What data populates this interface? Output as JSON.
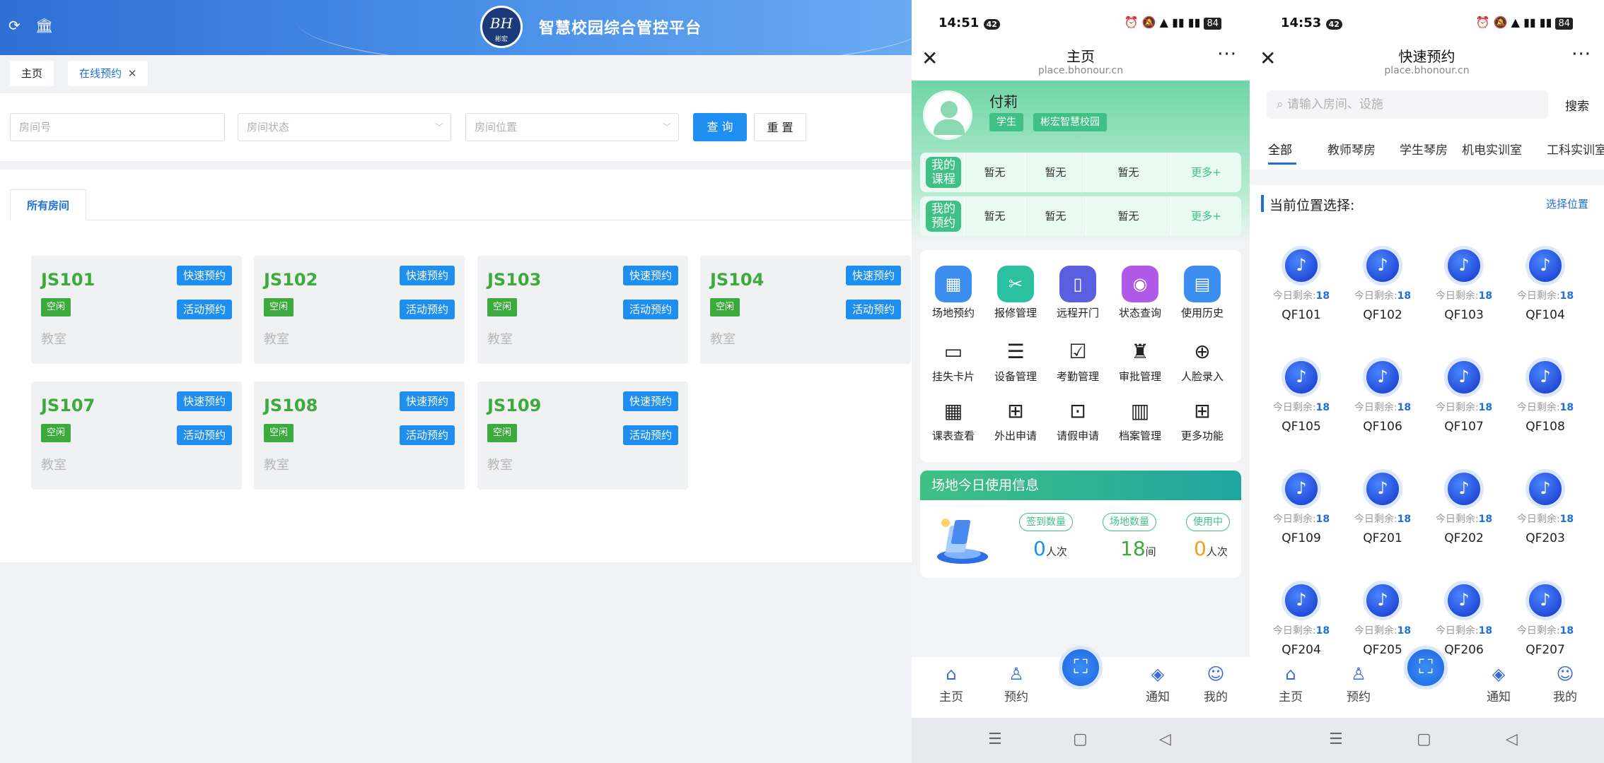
{
  "desktop": {
    "platform_title": "智慧校园综合管控平台",
    "logo_text": "BH",
    "logo_sub": "彬宏",
    "tabs": {
      "home": "主页",
      "booking": "在线预约",
      "close": "✕"
    },
    "filters": {
      "room_no": "房间号",
      "room_status": "房间状态",
      "room_location": "房间位置",
      "query": "查 询",
      "reset": "重 置"
    },
    "room_tab": "所有房间",
    "rooms": [
      {
        "name": "JS101",
        "status": "空闲",
        "type": "教室"
      },
      {
        "name": "JS102",
        "status": "空闲",
        "type": "教室"
      },
      {
        "name": "JS103",
        "status": "空闲",
        "type": "教室"
      },
      {
        "name": "JS104",
        "status": "空闲",
        "type": "教室"
      },
      {
        "name": "JS107",
        "status": "空闲",
        "type": "教室"
      },
      {
        "name": "JS108",
        "status": "空闲",
        "type": "教室"
      },
      {
        "name": "JS109",
        "status": "空闲",
        "type": "教室"
      }
    ],
    "quick_book": "快速预约",
    "activity_book": "活动预约"
  },
  "phone1": {
    "time": "14:51",
    "badge": "42",
    "battery": "84",
    "title": "主页",
    "url": "place.bhonour.cn",
    "user": {
      "name": "付莉",
      "role": "学生",
      "school": "彬宏智慧校园"
    },
    "courses_label": "我的课程",
    "reserve_label": "我的预约",
    "none": "暂无",
    "more": "更多+",
    "grid": [
      {
        "label": "场地预约",
        "icon": "calendar-icon",
        "color": "#3b8df0"
      },
      {
        "label": "报修管理",
        "icon": "tools-icon",
        "color": "#2bc0a0"
      },
      {
        "label": "远程开门",
        "icon": "door-icon",
        "color": "#5a5fe0"
      },
      {
        "label": "状态查询",
        "icon": "status-icon",
        "color": "#b058e8"
      },
      {
        "label": "使用历史",
        "icon": "history-icon",
        "color": "#3b8df0"
      },
      {
        "label": "挂失卡片",
        "icon": "card-icon"
      },
      {
        "label": "设备管理",
        "icon": "device-icon"
      },
      {
        "label": "考勤管理",
        "icon": "attendance-icon"
      },
      {
        "label": "审批管理",
        "icon": "approval-icon"
      },
      {
        "label": "人脸录入",
        "icon": "face-icon"
      },
      {
        "label": "课表查看",
        "icon": "schedule-icon"
      },
      {
        "label": "外出申请",
        "icon": "out-icon"
      },
      {
        "label": "请假申请",
        "icon": "leave-icon"
      },
      {
        "label": "档案管理",
        "icon": "archive-icon"
      },
      {
        "label": "更多功能",
        "icon": "more-icon"
      }
    ],
    "usage": {
      "title": "场地今日使用信息",
      "sign_label": "签到数量",
      "sign_value": "0",
      "sign_unit": "人次",
      "venue_label": "场地数量",
      "venue_value": "18",
      "venue_unit": "间",
      "inuse_label": "使用中",
      "inuse_value": "0",
      "inuse_unit": "人次"
    },
    "tabbar": {
      "home": "主页",
      "book": "预约",
      "notice": "通知",
      "mine": "我的"
    }
  },
  "phone2": {
    "time": "14:53",
    "badge": "42",
    "battery": "84",
    "title": "快速预约",
    "url": "place.bhonour.cn",
    "search_placeholder": "请输入房间、设施",
    "search": "搜索",
    "categories": [
      "全部",
      "教师琴房",
      "学生琴房",
      "机电实训室",
      "工科实训室"
    ],
    "position_title": "当前位置选择:",
    "choose_position": "选择位置",
    "remain_label": "今日剩余:",
    "rooms": [
      {
        "name": "QF101",
        "remain": "18"
      },
      {
        "name": "QF102",
        "remain": "18"
      },
      {
        "name": "QF103",
        "remain": "18"
      },
      {
        "name": "QF104",
        "remain": "18"
      },
      {
        "name": "QF105",
        "remain": "18"
      },
      {
        "name": "QF106",
        "remain": "18"
      },
      {
        "name": "QF107",
        "remain": "18"
      },
      {
        "name": "QF108",
        "remain": "18"
      },
      {
        "name": "QF109",
        "remain": "18"
      },
      {
        "name": "QF201",
        "remain": "18"
      },
      {
        "name": "QF202",
        "remain": "18"
      },
      {
        "name": "QF203",
        "remain": "18"
      },
      {
        "name": "QF204",
        "remain": "18"
      },
      {
        "name": "QF205",
        "remain": "18"
      },
      {
        "name": "QF206",
        "remain": "18"
      },
      {
        "name": "QF207",
        "remain": "18"
      }
    ],
    "tabbar": {
      "home": "主页",
      "book": "预约",
      "notice": "通知",
      "mine": "我的"
    }
  }
}
